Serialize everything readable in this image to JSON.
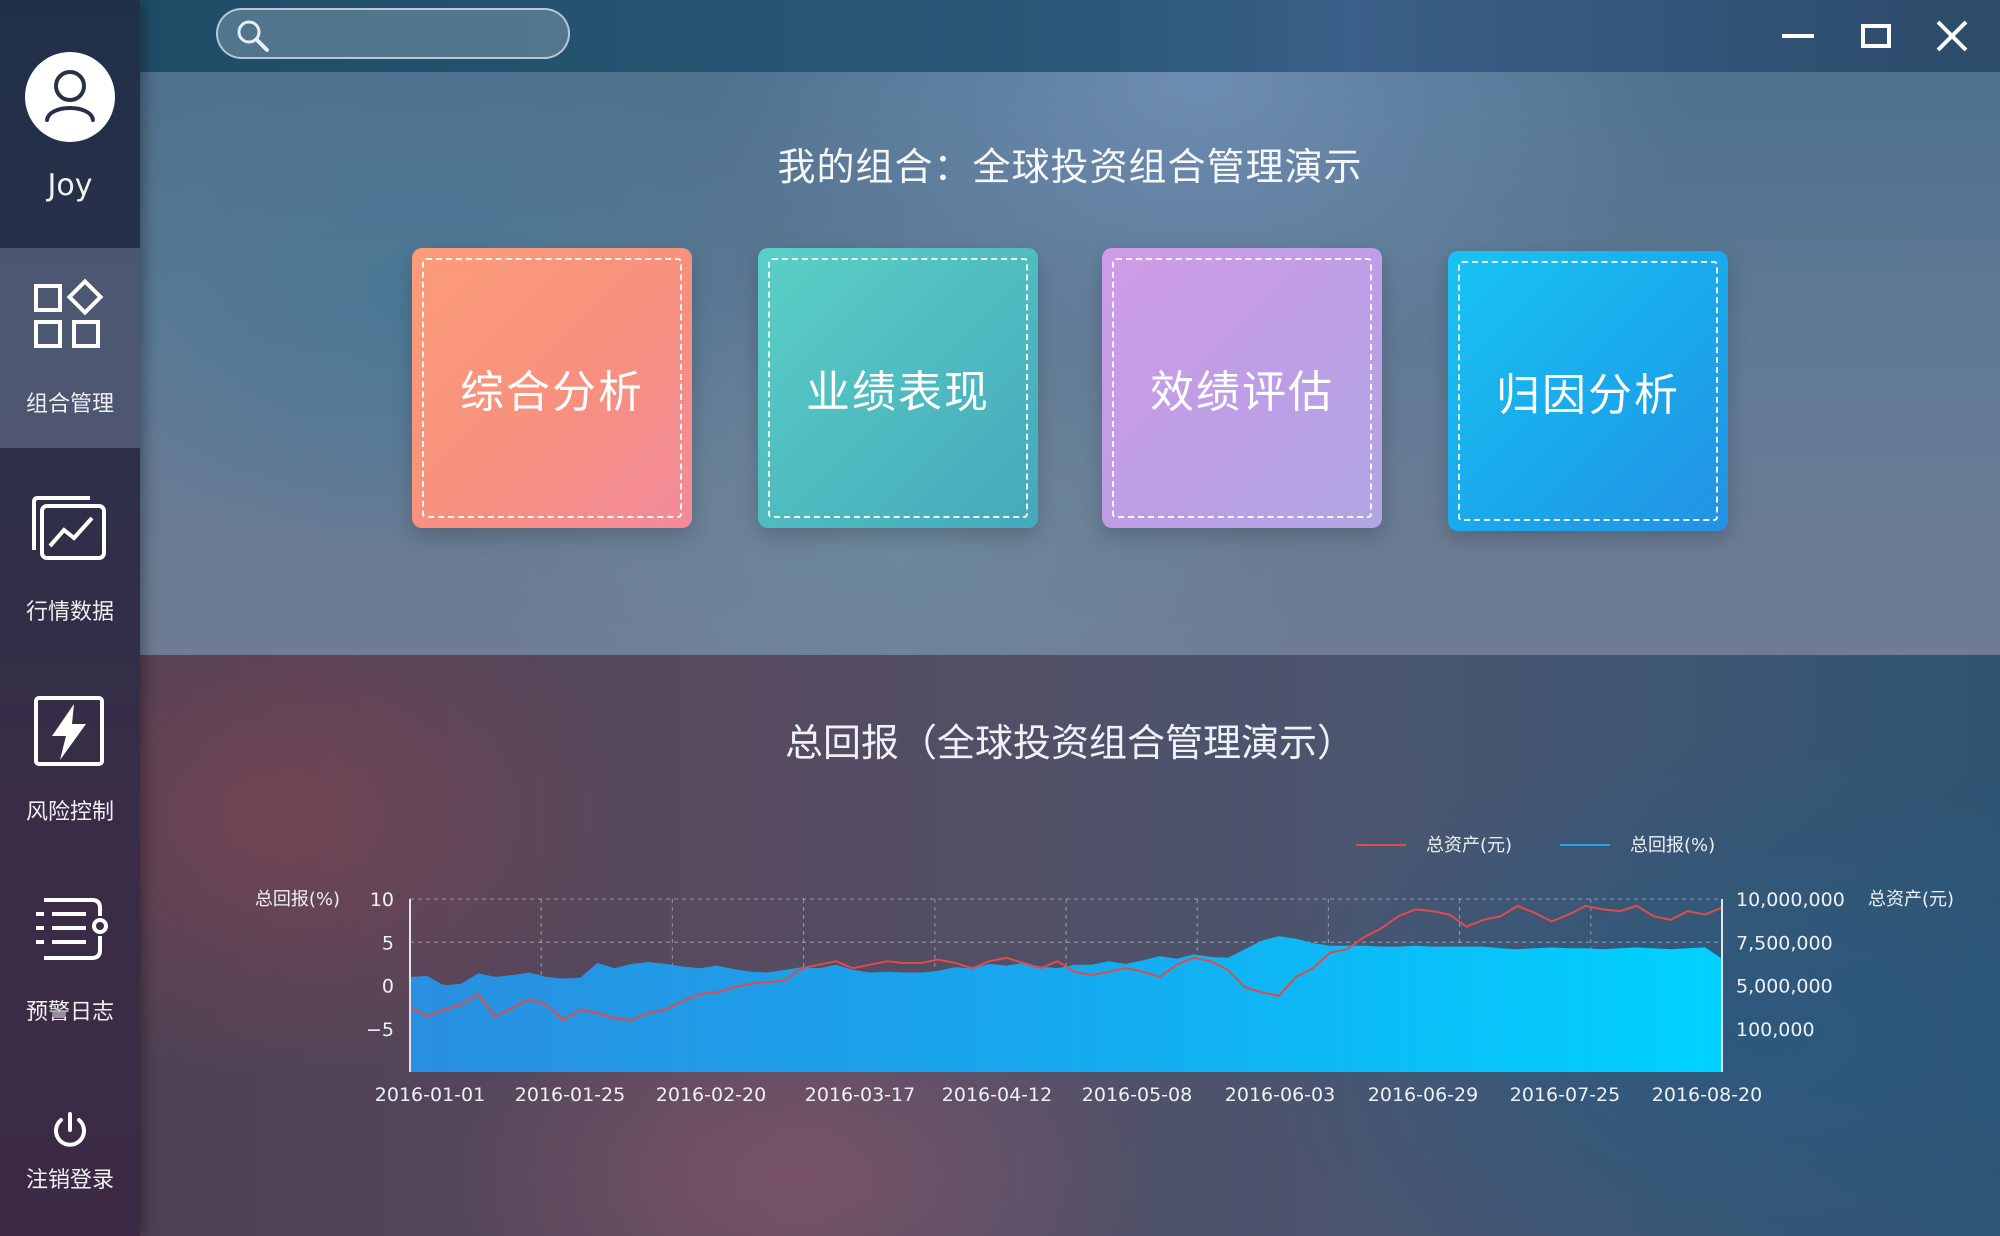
{
  "sidebar": {
    "username": "Joy",
    "items": [
      {
        "label": "组合管理"
      },
      {
        "label": "行情数据"
      },
      {
        "label": "风险控制"
      },
      {
        "label": "预警日志"
      },
      {
        "label": "注销登录"
      }
    ]
  },
  "search": {
    "placeholder": ""
  },
  "header": {
    "title": "我的组合：全球投资组合管理演示"
  },
  "cards": [
    {
      "label": "综合分析"
    },
    {
      "label": "业绩表现"
    },
    {
      "label": "效绩评估"
    },
    {
      "label": "归因分析"
    }
  ],
  "colors": {
    "asset_line": "#e04b4b",
    "return_area": "#16a9ef",
    "card1": "#f7907e",
    "card2": "#4fbcc0",
    "card3": "#bd9ee6",
    "card4": "#1aa8ec"
  },
  "chart_data": {
    "type": "area",
    "title": "总回报（全球投资组合管理演示）",
    "legend": [
      "总资产(元)",
      "总回报(%)"
    ],
    "legend_position": "top-right",
    "ylabel_left": "总回报(%)",
    "ylabel_right": "总资产(元)",
    "yticks_left": [
      "10",
      "5",
      "0",
      "−5"
    ],
    "yticks_right": [
      "10,000,000",
      "7,500,000",
      "5,000,000",
      "100,000"
    ],
    "ylim_left": [
      -10,
      10
    ],
    "xticks": [
      "2016-01-01",
      "2016-01-25",
      "2016-02-20",
      "2016-03-17",
      "2016-04-12",
      "2016-05-08",
      "2016-06-03",
      "2016-06-29",
      "2016-07-25",
      "2016-08-20"
    ],
    "grid": true,
    "series": [
      {
        "name": "总回报(%)",
        "type": "area",
        "values": [
          1.0,
          1.1,
          0.0,
          0.2,
          1.4,
          1.0,
          1.2,
          1.5,
          1.0,
          0.8,
          0.9,
          2.6,
          2.0,
          2.5,
          2.7,
          2.5,
          2.2,
          2.0,
          2.3,
          1.9,
          1.6,
          1.5,
          1.8,
          2.1,
          2.0,
          2.4,
          1.8,
          1.5,
          1.6,
          1.5,
          1.5,
          1.7,
          2.1,
          2.0,
          2.5,
          2.3,
          2.6,
          2.2,
          2.0,
          2.4,
          2.4,
          2.8,
          2.5,
          2.9,
          3.4,
          3.1,
          3.6,
          3.3,
          3.2,
          4.2,
          5.2,
          5.7,
          5.4,
          4.9,
          4.6,
          4.6,
          4.6,
          4.5,
          4.5,
          4.6,
          4.5,
          4.5,
          4.5,
          4.5,
          4.3,
          4.2,
          4.3,
          4.4,
          4.3,
          4.3,
          4.2,
          4.3,
          4.4,
          4.3,
          4.2,
          4.3,
          4.4,
          3.1
        ]
      },
      {
        "name": "总资产(元)",
        "type": "line",
        "values": [
          3.8,
          3.2,
          3.6,
          3.9,
          4.5,
          3.2,
          3.7,
          4.2,
          3.9,
          3.0,
          3.6,
          3.4,
          3.1,
          3.0,
          3.4,
          3.6,
          4.1,
          4.5,
          4.6,
          4.9,
          5.1,
          5.2,
          5.3,
          6.0,
          6.2,
          6.4,
          6.0,
          6.2,
          6.4,
          6.3,
          6.3,
          6.5,
          6.3,
          6.0,
          6.4,
          6.6,
          6.3,
          6.0,
          6.4,
          5.8,
          5.6,
          5.8,
          6.0,
          5.8,
          5.5,
          6.2,
          6.6,
          6.4,
          5.9,
          4.9,
          4.6,
          4.4,
          5.5,
          6.0,
          6.9,
          7.1,
          7.8,
          8.3,
          9.0,
          9.4,
          9.3,
          9.1,
          8.4,
          8.8,
          9.0,
          9.6,
          9.2,
          8.7,
          9.1,
          9.6,
          9.4,
          9.3,
          9.6,
          9.0,
          8.8,
          9.3,
          9.1,
          9.5
        ]
      }
    ]
  }
}
